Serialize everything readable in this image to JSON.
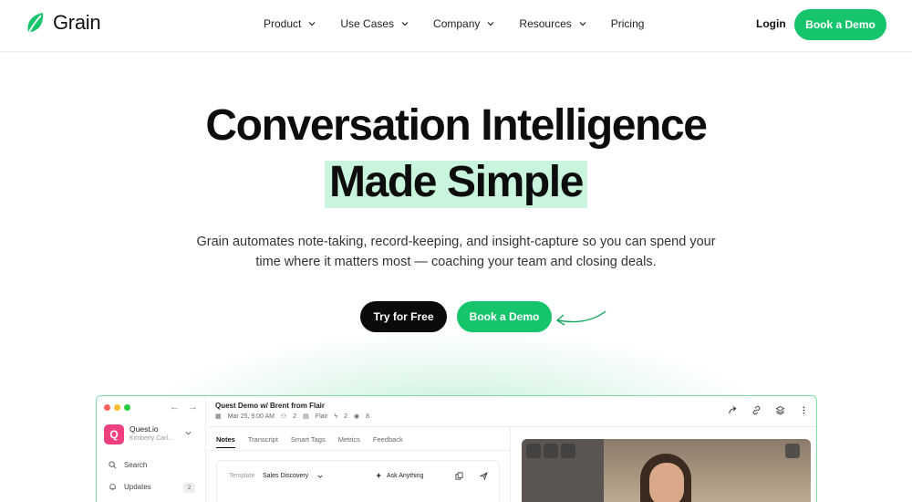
{
  "nav": {
    "brand": "Grain",
    "links": [
      {
        "label": "Product",
        "has_dropdown": true
      },
      {
        "label": "Use Cases",
        "has_dropdown": true
      },
      {
        "label": "Company",
        "has_dropdown": true
      },
      {
        "label": "Resources",
        "has_dropdown": true
      },
      {
        "label": "Pricing",
        "has_dropdown": false
      }
    ],
    "login": "Login",
    "cta": "Book a Demo"
  },
  "hero": {
    "title_line1": "Conversation Intelligence",
    "title_line2": "Made Simple",
    "subtitle": "Grain automates note-taking, record-keeping, and insight-capture so you can spend your time where it matters most — coaching your team and closing deals.",
    "primary_button": "Try for Free",
    "secondary_button": "Book a Demo"
  },
  "app": {
    "workspace": {
      "logo_letter": "Q",
      "name": "Quest.io",
      "user": "Kimberly Carl..."
    },
    "sidebar": [
      {
        "label": "Search",
        "icon": "search-icon"
      },
      {
        "label": "Updates",
        "icon": "bell-icon",
        "badge": "2"
      }
    ],
    "meeting": {
      "title": "Quest Demo w/ Brent from Flair",
      "date": "Mar 25, 9:00 AM",
      "participants": "2",
      "company": "Flair",
      "clips": "2",
      "views": "8"
    },
    "tabs": [
      "Notes",
      "Transcript",
      "Smart Tags",
      "Metrics",
      "Feedback"
    ],
    "active_tab": "Notes",
    "note_card": {
      "template_label": "Template",
      "template_value": "Sales Discovery",
      "ask": "Ask Anything"
    }
  },
  "colors": {
    "brand": "#16c46b",
    "highlight": "#c8f5dc",
    "dark": "#0b0b0b"
  }
}
